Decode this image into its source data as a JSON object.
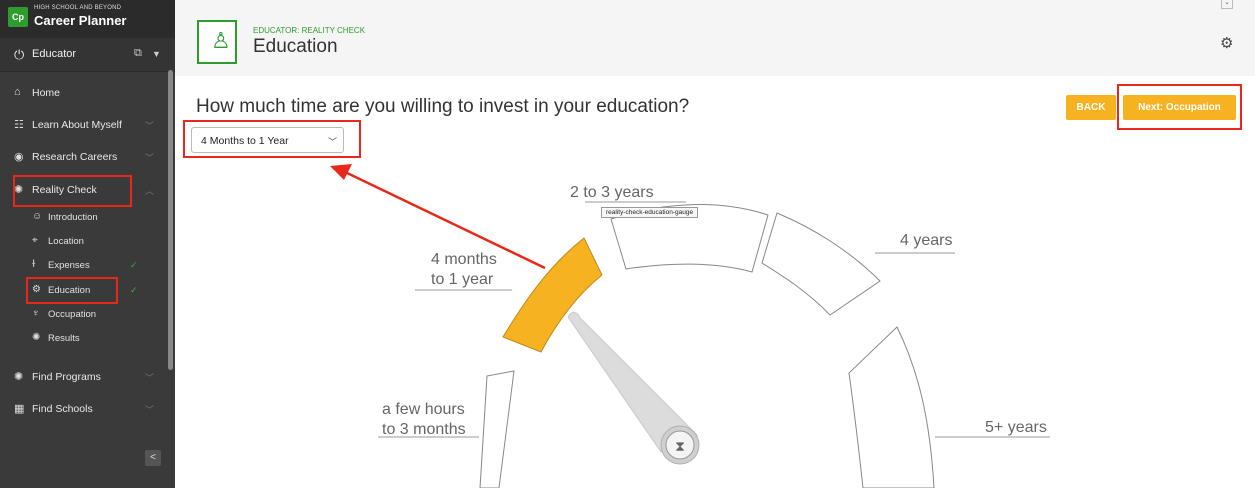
{
  "brand": {
    "logo": "Cp",
    "small": "HIGH SCHOOL AND BEYOND",
    "title": "Career Planner"
  },
  "role": {
    "label": "Educator"
  },
  "sidebar": {
    "items": [
      {
        "label": "Home",
        "icon": "home-icon"
      },
      {
        "label": "Learn About Myself",
        "icon": "brain-icon"
      },
      {
        "label": "Research Careers",
        "icon": "compass-icon"
      },
      {
        "label": "Reality Check",
        "icon": "lightbulb-icon"
      },
      {
        "label": "Find Programs",
        "icon": "lightbulb-icon"
      },
      {
        "label": "Find Schools",
        "icon": "school-icon"
      }
    ],
    "subitems": [
      {
        "label": "Introduction",
        "icon": "person-icon"
      },
      {
        "label": "Location",
        "icon": "map-icon"
      },
      {
        "label": "Expenses",
        "icon": "money-icon"
      },
      {
        "label": "Education",
        "icon": "gear-icon"
      },
      {
        "label": "Occupation",
        "icon": "trophy-icon"
      },
      {
        "label": "Results",
        "icon": "lightbulb-icon"
      }
    ]
  },
  "header": {
    "subtitle": "EDUCATOR: REALITY CHECK",
    "title": "Education"
  },
  "main": {
    "question": "How much time are you willing to invest in your education?",
    "dropdown_value": "4 Months to 1 Year",
    "back_label": "BACK",
    "next_label": "Next: Occupation",
    "tooltip": "reality-check-education-gauge",
    "gauge": {
      "options": [
        {
          "line1": "a few hours",
          "line2": "to 3 months"
        },
        {
          "line1": "4 months",
          "line2": "to 1 year"
        },
        {
          "line1": "2 to 3 years",
          "line2": ""
        },
        {
          "line1": "4 years",
          "line2": ""
        },
        {
          "line1": "5+ years",
          "line2": ""
        }
      ],
      "selected_index": 1
    }
  },
  "colors": {
    "accent": "#f6b221",
    "brand_green": "#2e9c2e",
    "annotation_red": "#e8281a"
  }
}
